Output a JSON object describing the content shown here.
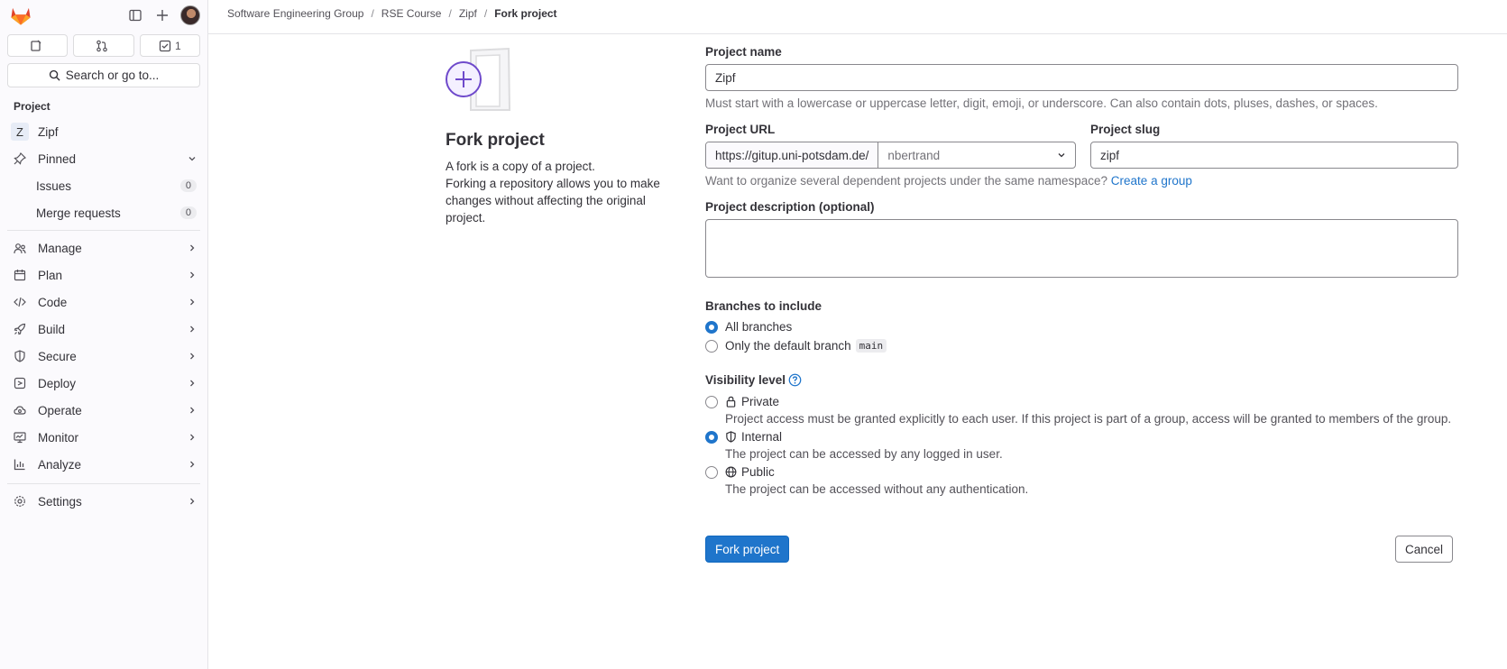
{
  "sidebar": {
    "counts": {
      "issues": "",
      "merge_requests": "",
      "todos": "1"
    },
    "search_label": "Search or go to...",
    "section_title": "Project",
    "project": {
      "initial": "Z",
      "name": "Zipf"
    },
    "pinned": {
      "label": "Pinned",
      "items": [
        {
          "label": "Issues",
          "count": "0"
        },
        {
          "label": "Merge requests",
          "count": "0"
        }
      ]
    },
    "nav": [
      {
        "label": "Manage",
        "icon": "users-icon"
      },
      {
        "label": "Plan",
        "icon": "calendar-icon"
      },
      {
        "label": "Code",
        "icon": "code-icon"
      },
      {
        "label": "Build",
        "icon": "rocket-icon"
      },
      {
        "label": "Secure",
        "icon": "shield-icon"
      },
      {
        "label": "Deploy",
        "icon": "deploy-icon"
      },
      {
        "label": "Operate",
        "icon": "cloud-gear-icon"
      },
      {
        "label": "Monitor",
        "icon": "monitor-icon"
      },
      {
        "label": "Analyze",
        "icon": "chart-icon"
      }
    ],
    "settings": "Settings"
  },
  "breadcrumb": [
    "Software Engineering Group",
    "RSE Course",
    "Zipf",
    "Fork project"
  ],
  "intro": {
    "title": "Fork project",
    "line1": "A fork is a copy of a project.",
    "line2": "Forking a repository allows you to make changes without affecting the original project."
  },
  "form": {
    "name_label": "Project name",
    "name_value": "Zipf",
    "name_help": "Must start with a lowercase or uppercase letter, digit, emoji, or underscore. Can also contain dots, pluses, dashes, or spaces.",
    "url_label": "Project URL",
    "url_prefix": "https://gitup.uni-potsdam.de/",
    "namespace": "nbertrand",
    "slug_label": "Project slug",
    "slug_value": "zipf",
    "group_help": "Want to organize several dependent projects under the same namespace?",
    "group_link": "Create a group",
    "desc_label": "Project description (optional)",
    "branches_label": "Branches to include",
    "branch_all": "All branches",
    "branch_default": "Only the default branch",
    "branch_default_code": "main",
    "visibility_label": "Visibility level",
    "visibility": [
      {
        "label": "Private",
        "desc": "Project access must be granted explicitly to each user. If this project is part of a group, access will be granted to members of the group.",
        "checked": false
      },
      {
        "label": "Internal",
        "desc": "The project can be accessed by any logged in user.",
        "checked": true
      },
      {
        "label": "Public",
        "desc": "The project can be accessed without any authentication.",
        "checked": false
      }
    ],
    "submit": "Fork project",
    "cancel": "Cancel"
  },
  "colors": {
    "primary": "#1f75cb",
    "accent": "#6e49cb",
    "logo": "#e24329"
  }
}
